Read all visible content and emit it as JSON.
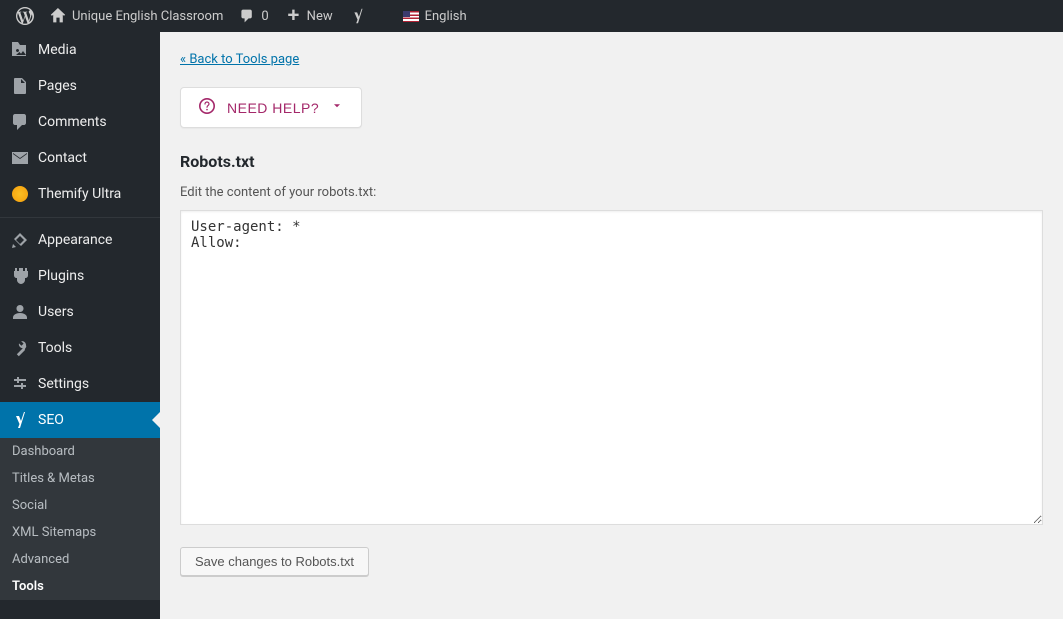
{
  "topbar": {
    "site_title": "Unique English Classroom",
    "comments_count": "0",
    "new_label": "New",
    "language": "English"
  },
  "sidebar": {
    "items": [
      {
        "label": "Media"
      },
      {
        "label": "Pages"
      },
      {
        "label": "Comments"
      },
      {
        "label": "Contact"
      },
      {
        "label": "Themify Ultra"
      },
      {
        "label": "Appearance"
      },
      {
        "label": "Plugins"
      },
      {
        "label": "Users"
      },
      {
        "label": "Tools"
      },
      {
        "label": "Settings"
      },
      {
        "label": "SEO"
      }
    ],
    "sub_items": [
      {
        "label": "Dashboard"
      },
      {
        "label": "Titles & Metas"
      },
      {
        "label": "Social"
      },
      {
        "label": "XML Sitemaps"
      },
      {
        "label": "Advanced"
      },
      {
        "label": "Tools"
      }
    ]
  },
  "main": {
    "back_link": "« Back to Tools page",
    "help_button": "NEED HELP?",
    "section_title": "Robots.txt",
    "section_desc": "Edit the content of your robots.txt:",
    "robots_content": "User-agent: *\nAllow:",
    "save_button": "Save changes to Robots.txt"
  }
}
